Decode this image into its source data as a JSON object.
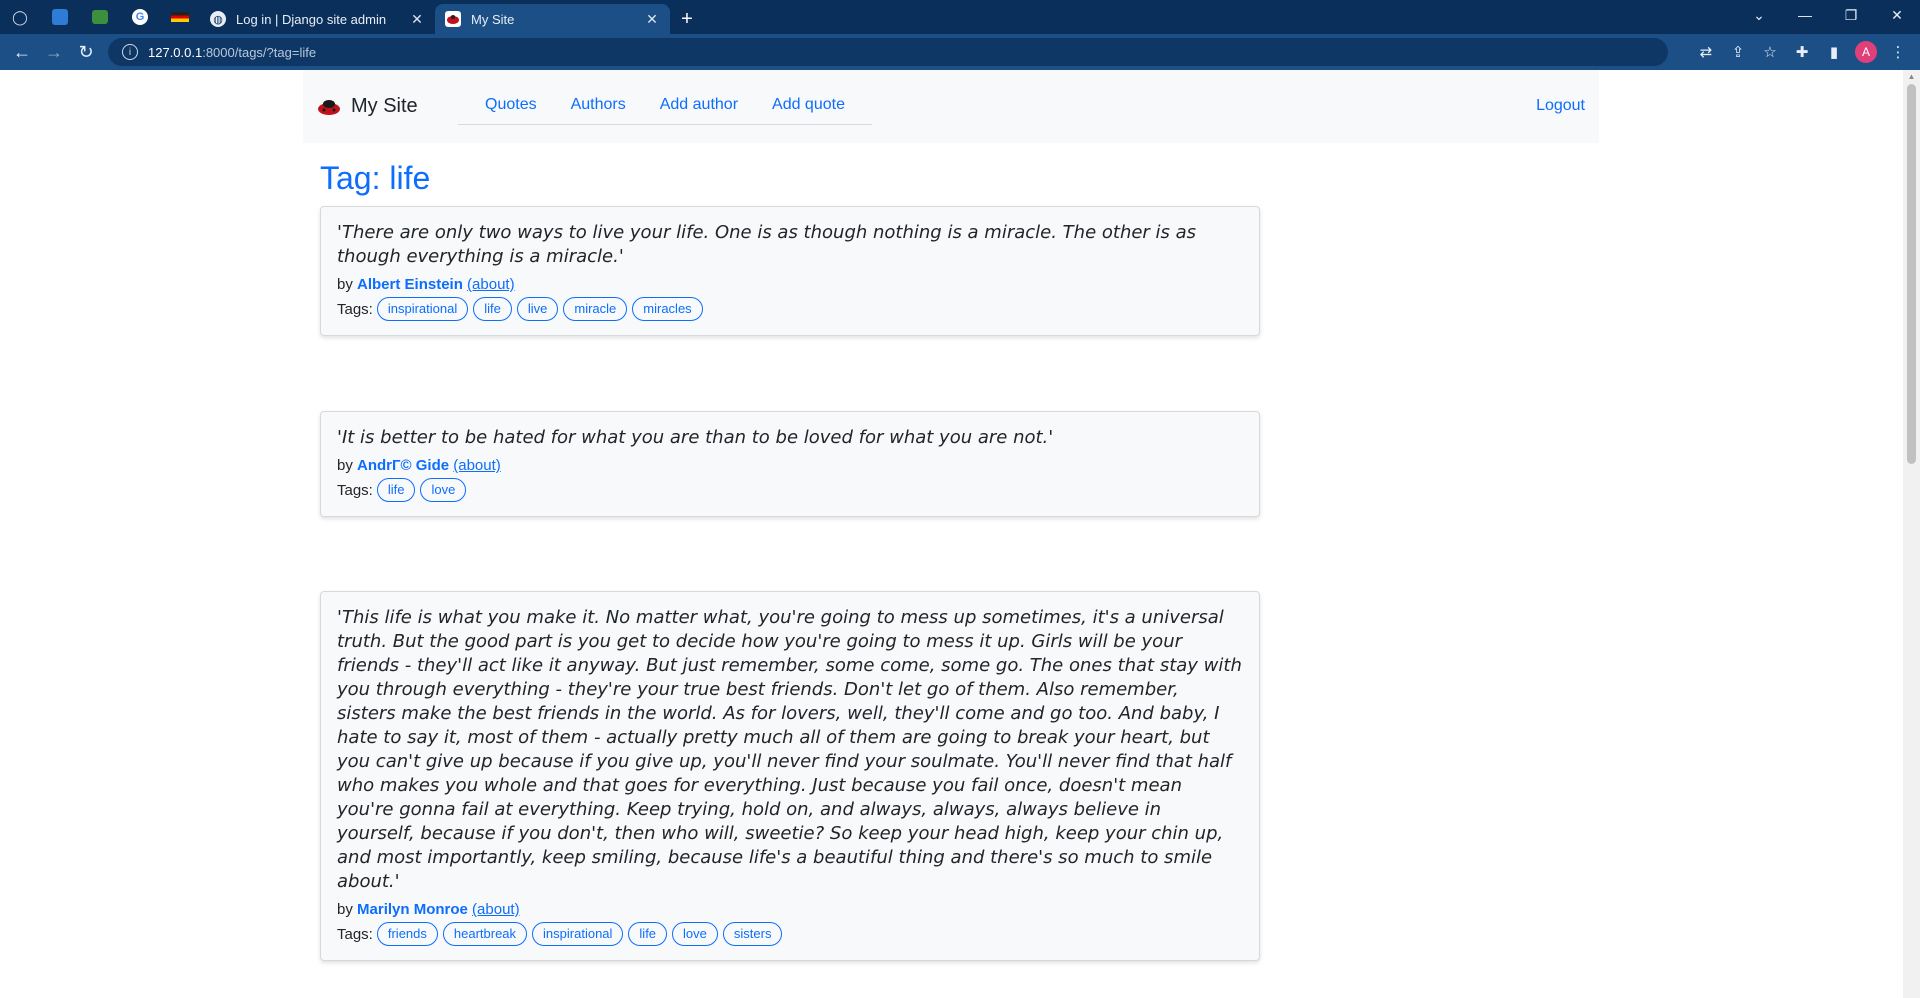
{
  "browser": {
    "tabs": [
      {
        "title": "Log in | Django site admin",
        "active": false
      },
      {
        "title": "My Site",
        "active": true
      }
    ],
    "url_host": "127.0.0.1",
    "url_path": ":8000/tags/?tag=life"
  },
  "site": {
    "brand": "My Site",
    "nav": [
      "Quotes",
      "Authors",
      "Add author",
      "Add quote"
    ],
    "logout": "Logout"
  },
  "page": {
    "title": "Tag: life"
  },
  "quotes": [
    {
      "text": "'There are only two ways to live your life. One is as though nothing is a miracle. The other is as though everything is a miracle.'",
      "by": "by",
      "author": "Albert Einstein",
      "about": "(about)",
      "tags_label": "Tags:",
      "tags": [
        "inspirational",
        "life",
        "live",
        "miracle",
        "miracles"
      ]
    },
    {
      "text": "'It is better to be hated for what you are than to be loved for what you are not.'",
      "by": "by",
      "author": "AndrГ© Gide",
      "about": "(about)",
      "tags_label": "Tags:",
      "tags": [
        "life",
        "love"
      ]
    },
    {
      "text": "'This life is what you make it. No matter what, you're going to mess up sometimes, it's a universal truth. But the good part is you get to decide how you're going to mess it up. Girls will be your friends - they'll act like it anyway. But just remember, some come, some go. The ones that stay with you through everything - they're your true best friends. Don't let go of them. Also remember, sisters make the best friends in the world. As for lovers, well, they'll come and go too. And baby, I hate to say it, most of them - actually pretty much all of them are going to break your heart, but you can't give up because if you give up, you'll never find your soulmate. You'll never find that half who makes you whole and that goes for everything. Just because you fail once, doesn't mean you're gonna fail at everything. Keep trying, hold on, and always, always, always believe in yourself, because if you don't, then who will, sweetie? So keep your head high, keep your chin up, and most importantly, keep smiling, because life's a beautiful thing and there's so much to smile about.'",
      "by": "by",
      "author": "Marilyn Monroe",
      "about": "(about)",
      "tags_label": "Tags:",
      "tags": [
        "friends",
        "heartbreak",
        "inspirational",
        "life",
        "love",
        "sisters"
      ]
    }
  ],
  "colors": {
    "link": "#0d6efd",
    "chrome_dark": "#0b2f5b",
    "chrome_active": "#1b4f86"
  }
}
